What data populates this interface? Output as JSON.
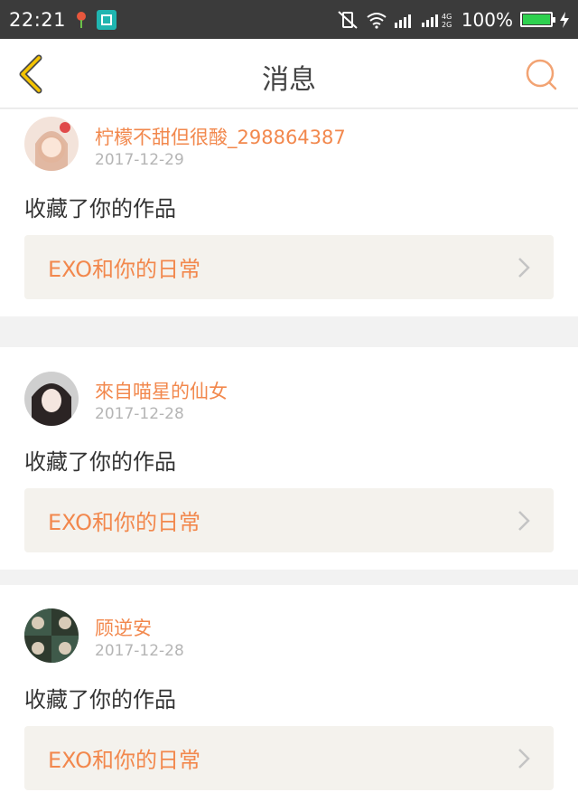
{
  "status_bar": {
    "time": "22:21",
    "battery_pct": "100%"
  },
  "nav": {
    "title": "消息"
  },
  "messages": [
    {
      "user": "柠檬不甜但很酸_298864387",
      "date": "2017-12-29",
      "action": "收藏了你的作品",
      "work": "EXO和你的日常"
    },
    {
      "user": "來自喵星的仙女",
      "date": "2017-12-28",
      "action": "收藏了你的作品",
      "work": "EXO和你的日常"
    },
    {
      "user": "顾逆安",
      "date": "2017-12-28",
      "action": "收藏了你的作品",
      "work": "EXO和你的日常"
    }
  ],
  "colors": {
    "accent": "#f2884d",
    "back_icon": "#f5c400"
  }
}
